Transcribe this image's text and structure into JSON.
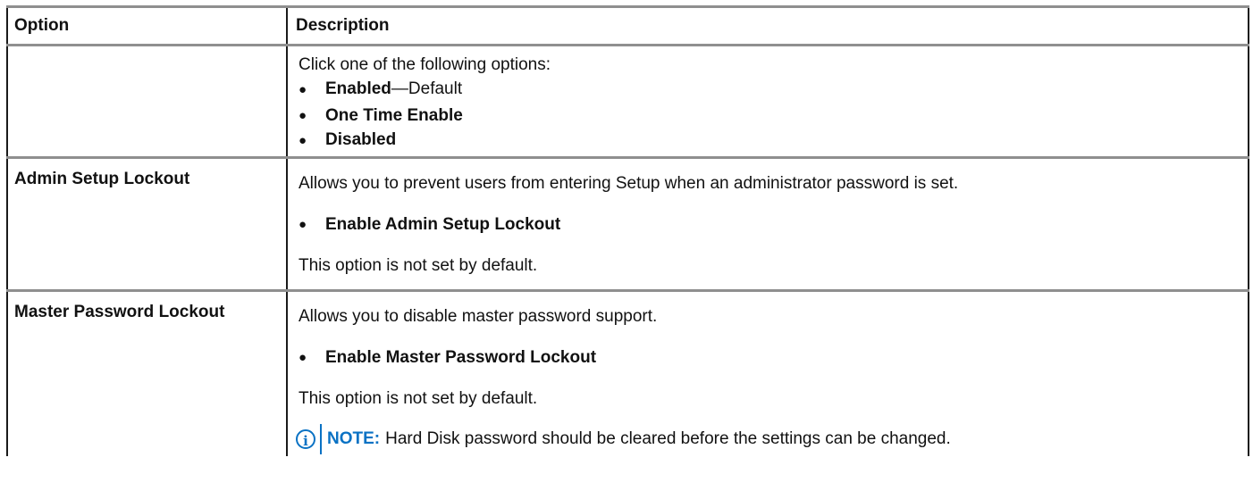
{
  "table": {
    "headers": {
      "option": "Option",
      "description": "Description"
    },
    "rows": [
      {
        "option": "",
        "intro": "Click one of the following options:",
        "items": [
          {
            "bold": "Enabled",
            "rest": "—Default"
          },
          {
            "bold": "One Time Enable",
            "rest": ""
          },
          {
            "bold": "Disabled",
            "rest": ""
          }
        ]
      },
      {
        "option": "Admin Setup Lockout",
        "intro": "Allows you to prevent users from entering Setup when an administrator password is set.",
        "items": [
          {
            "bold": "Enable Admin Setup Lockout"
          }
        ],
        "footer": "This option is not set by default."
      },
      {
        "option": "Master Password Lockout",
        "intro": "Allows you to disable master password support.",
        "items": [
          {
            "bold": "Enable Master Password Lockout"
          }
        ],
        "footer": "This option is not set by default.",
        "note": {
          "icon": "info-icon",
          "label": "NOTE:",
          "text": "Hard Disk password should be cleared before the settings can be changed."
        }
      }
    ]
  },
  "bullet_glyph": "●",
  "colors": {
    "note_accent": "#0a72c4"
  }
}
